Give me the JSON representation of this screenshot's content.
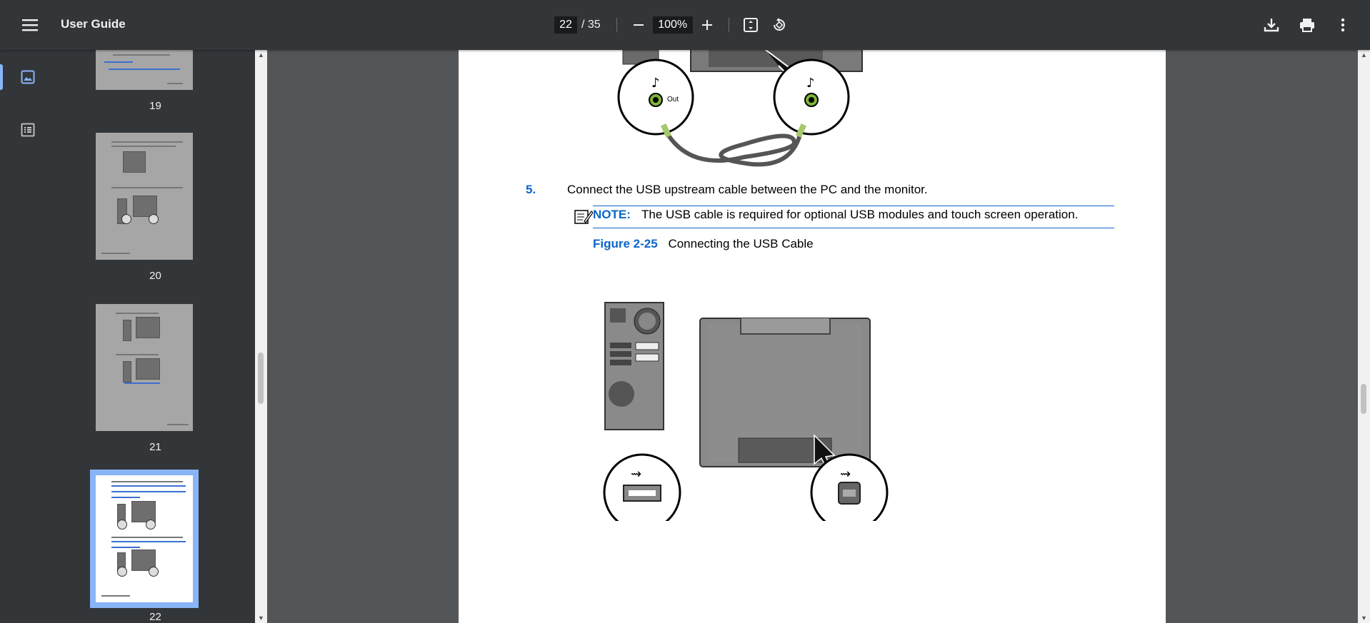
{
  "toolbar": {
    "title": "User Guide",
    "current_page": "22",
    "page_total": "/ 35",
    "zoom": "100%"
  },
  "sidebar": {
    "thumbnails": [
      {
        "label": "19"
      },
      {
        "label": "20"
      },
      {
        "label": "21"
      },
      {
        "label": "22",
        "selected": true
      }
    ]
  },
  "document": {
    "step_number": "5.",
    "step_text": "Connect the USB upstream cable between the PC and the monitor.",
    "note_label": "NOTE:",
    "note_text": "The USB cable is required for optional USB modules and touch screen operation.",
    "figure_number": "Figure 2-25",
    "figure_caption": "Connecting the USB Cable",
    "upper_figure_label": "Out"
  },
  "colors": {
    "accent_blue": "#0b65c9",
    "toolbar_bg": "#323639",
    "viewer_bg": "#525659",
    "selection": "#8ab4f8"
  }
}
